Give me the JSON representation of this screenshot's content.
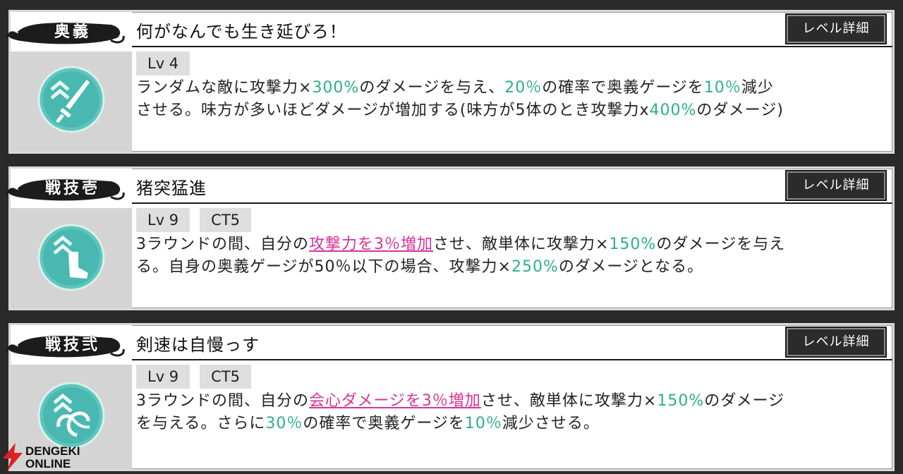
{
  "colors": {
    "accent_green": "#2bb08a",
    "accent_pink": "#d6339a",
    "icon_teal": "#49b8b0"
  },
  "detail_button_label": "レベル詳細",
  "skills": [
    {
      "category": "奥義",
      "title": "何がなんでも生き延びろ！",
      "icon": "sword-chevron-icon",
      "badges": [
        "Lv 4"
      ],
      "desc_line1": [
        {
          "t": "ランダムな敵に攻撃力×",
          "c": ""
        },
        {
          "t": "300%",
          "c": "g"
        },
        {
          "t": "のダメージを与え、",
          "c": ""
        },
        {
          "t": "20％",
          "c": "g"
        },
        {
          "t": "の確率で奥義ゲージを",
          "c": ""
        },
        {
          "t": "10％",
          "c": "g"
        },
        {
          "t": "減少",
          "c": ""
        }
      ],
      "desc_line2": [
        {
          "t": "させる。味方が多いほどダメージが増加する(味方が5体のとき攻撃力x",
          "c": ""
        },
        {
          "t": "400%",
          "c": "g"
        },
        {
          "t": "のダメージ)",
          "c": ""
        }
      ]
    },
    {
      "category": "戦技壱",
      "title": "猪突猛進",
      "icon": "boot-chevron-icon",
      "badges": [
        "Lv 9",
        "CT5"
      ],
      "desc_line1": [
        {
          "t": "3ラウンドの間、自分の",
          "c": ""
        },
        {
          "t": "攻撃力を3％増加",
          "c": "p"
        },
        {
          "t": "させ、敵単体に攻撃力×",
          "c": ""
        },
        {
          "t": "150%",
          "c": "g"
        },
        {
          "t": "のダメージを与え",
          "c": ""
        }
      ],
      "desc_line2": [
        {
          "t": "る。自身の奥義ゲージが50％以下の場合、攻撃力×",
          "c": ""
        },
        {
          "t": "250%",
          "c": "g"
        },
        {
          "t": "のダメージとなる。",
          "c": ""
        }
      ]
    },
    {
      "category": "戦技弐",
      "title": "剣速は自慢っす",
      "icon": "swirl-chevron-icon",
      "badges": [
        "Lv 9",
        "CT5"
      ],
      "desc_line1": [
        {
          "t": "3ラウンドの間、自分の",
          "c": ""
        },
        {
          "t": "会心ダメージを3％増加",
          "c": "p"
        },
        {
          "t": "させ、敵単体に攻撃力×",
          "c": ""
        },
        {
          "t": "150%",
          "c": "g"
        },
        {
          "t": "のダメージ",
          "c": ""
        }
      ],
      "desc_line2": [
        {
          "t": "を与える。さらに",
          "c": ""
        },
        {
          "t": "30％",
          "c": "g"
        },
        {
          "t": "の確率で奥義ゲージを",
          "c": ""
        },
        {
          "t": "10％",
          "c": "g"
        },
        {
          "t": "減少させる。",
          "c": ""
        }
      ]
    }
  ],
  "watermark": {
    "line1": "DENGEKI",
    "line2": "ONLINE"
  }
}
